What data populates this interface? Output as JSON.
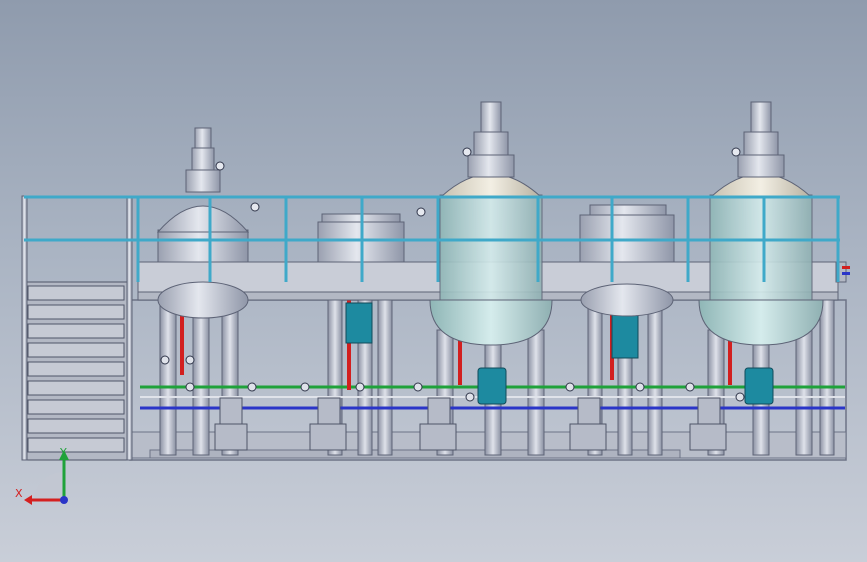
{
  "viewport": {
    "background_top": "#8f9bad",
    "background_bottom": "#c9ced8"
  },
  "model": {
    "colors": {
      "railing": "#3fa9c9",
      "steel": "#c4c9d6",
      "glass": "#b9d6d6",
      "hot_line": "#d21f1f",
      "green_line": "#1fa23a",
      "blue_line": "#2a35c8",
      "pump": "#1d8aa0"
    }
  },
  "triad": {
    "x_label": "X",
    "y_label": "Y",
    "x_color": "#d42020",
    "y_color": "#1fa23a",
    "z_color": "#2a35c8"
  }
}
